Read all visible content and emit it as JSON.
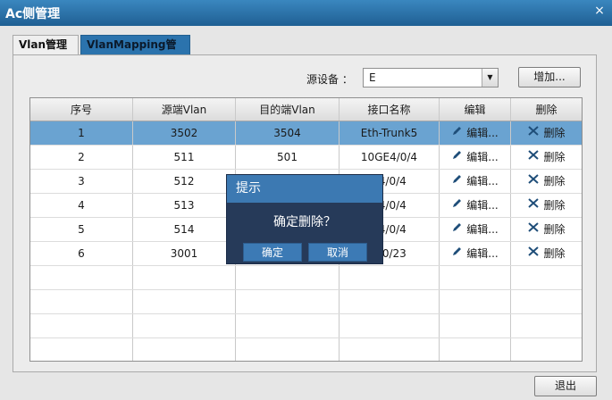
{
  "window": {
    "title": "Ac侧管理",
    "close_glyph": "×"
  },
  "tabs": [
    {
      "label": "Vlan管理"
    },
    {
      "label": "VlanMapping管理",
      "active": true
    }
  ],
  "filter": {
    "label": "源设备 ：",
    "selected": "E"
  },
  "buttons": {
    "add": "增加...",
    "exit": "退出"
  },
  "table": {
    "columns": [
      "序号",
      "源端Vlan",
      "目的端Vlan",
      "接口名称",
      "编辑",
      "删除"
    ],
    "rows": [
      {
        "idx": "1",
        "src": "3502",
        "dst": "3504",
        "iface": "Eth-Trunk5",
        "edit": "编辑...",
        "del": "删除",
        "selected": true
      },
      {
        "idx": "2",
        "src": "511",
        "dst": "501",
        "iface": "10GE4/0/4",
        "edit": "编辑...",
        "del": "删除"
      },
      {
        "idx": "3",
        "src": "512",
        "dst": "",
        "iface": "E4/0/4",
        "edit": "编辑...",
        "del": "删除"
      },
      {
        "idx": "4",
        "src": "513",
        "dst": "",
        "iface": "E4/0/4",
        "edit": "编辑...",
        "del": "删除"
      },
      {
        "idx": "5",
        "src": "514",
        "dst": "",
        "iface": "E4/0/4",
        "edit": "编辑...",
        "del": "删除"
      },
      {
        "idx": "6",
        "src": "3001",
        "dst": "",
        "iface": "4/0/23",
        "edit": "编辑...",
        "del": "删除"
      }
    ]
  },
  "dialog": {
    "title": "提示",
    "message": "确定删除？",
    "ok": "确定",
    "cancel": "取消"
  },
  "icons": {
    "edit": "pencil-icon",
    "delete": "cross-icon",
    "dropdown": "chevron-down-icon",
    "close": "close-icon"
  },
  "colors": {
    "titlebar": "#2a6fa6",
    "selected_row": "#6aa3d1",
    "dialog_bg": "#263a59",
    "dialog_head": "#3c79b2"
  }
}
